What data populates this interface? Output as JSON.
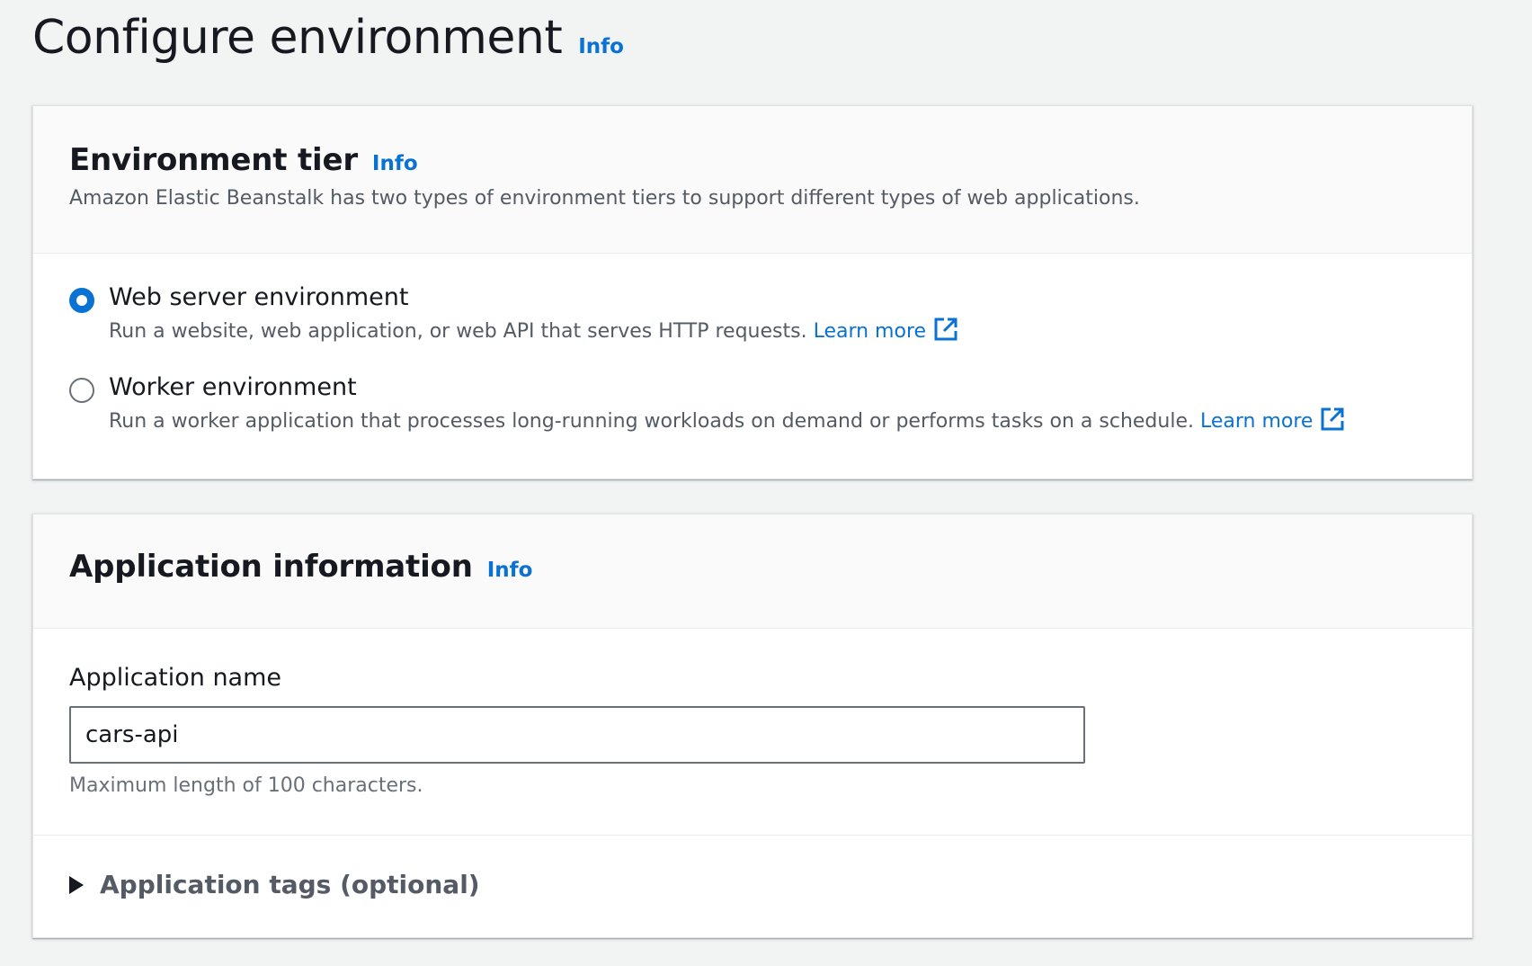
{
  "header": {
    "title": "Configure environment",
    "info": "Info"
  },
  "environment_tier": {
    "title": "Environment tier",
    "info": "Info",
    "description": "Amazon Elastic Beanstalk has two types of environment tiers to support different types of web applications.",
    "options": [
      {
        "label": "Web server environment",
        "description": "Run a website, web application, or web API that serves HTTP requests.",
        "link": "Learn more",
        "selected": true
      },
      {
        "label": "Worker environment",
        "description": "Run a worker application that processes long-running workloads on demand or performs tasks on a schedule.",
        "link": "Learn more",
        "selected": false
      }
    ]
  },
  "application_information": {
    "title": "Application information",
    "info": "Info",
    "name_label": "Application name",
    "name_value": "cars-api",
    "name_hint": "Maximum length of 100 characters.",
    "tags_label": "Application tags (optional)"
  },
  "colors": {
    "accent": "#0972d3",
    "background": "#f2f3f3"
  },
  "icons": {
    "external_link": "external-link-icon",
    "expand": "caret-right-icon"
  }
}
